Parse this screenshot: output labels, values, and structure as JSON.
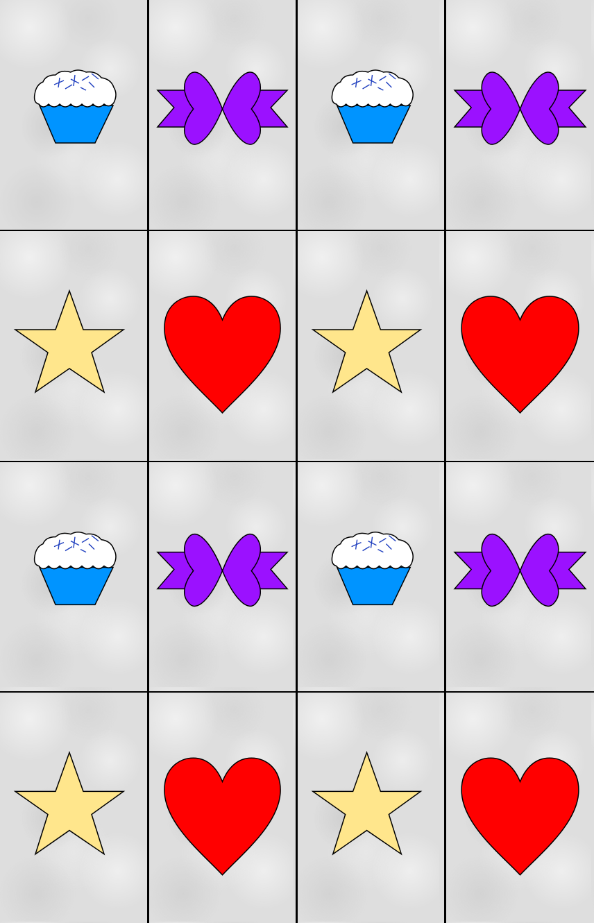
{
  "board": {
    "rows": 4,
    "columns": 4,
    "line_color": "#000000",
    "card_color": "#dedede"
  },
  "cards": [
    {
      "symbol": "cupcake-icon"
    },
    {
      "symbol": "bow-icon"
    },
    {
      "symbol": "cupcake-icon"
    },
    {
      "symbol": "bow-icon"
    },
    {
      "symbol": "star-icon"
    },
    {
      "symbol": "heart-icon"
    },
    {
      "symbol": "star-icon"
    },
    {
      "symbol": "heart-icon"
    },
    {
      "symbol": "cupcake-icon"
    },
    {
      "symbol": "bow-icon"
    },
    {
      "symbol": "cupcake-icon"
    },
    {
      "symbol": "bow-icon"
    },
    {
      "symbol": "star-icon"
    },
    {
      "symbol": "heart-icon"
    },
    {
      "symbol": "star-icon"
    },
    {
      "symbol": "heart-icon"
    }
  ],
  "colors": {
    "cupcake_wrapper": "#0094ff",
    "cupcake_frosting": "#ffffff",
    "cupcake_sprinkles": "#1f3fbf",
    "bow": "#9b11ff",
    "star": "#ffe68c",
    "heart": "#ff0000",
    "outline": "#000000"
  }
}
